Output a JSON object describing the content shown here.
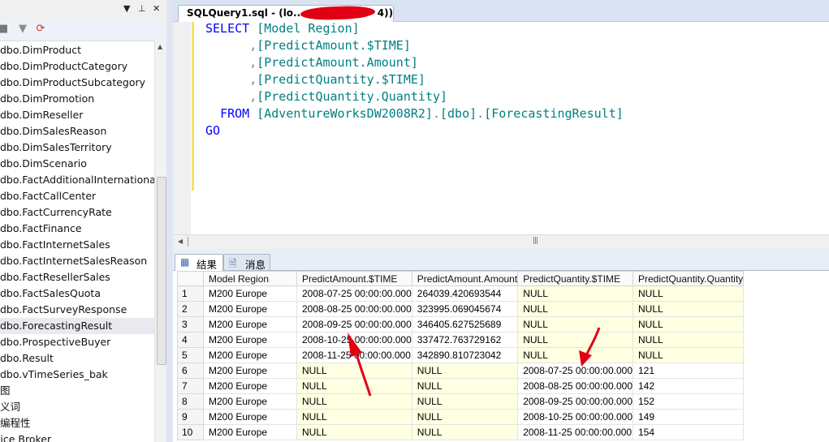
{
  "object_explorer": {
    "tables": [
      "dbo.DimProduct",
      "dbo.DimProductCategory",
      "dbo.DimProductSubcategory",
      "dbo.DimPromotion",
      "dbo.DimReseller",
      "dbo.DimSalesReason",
      "dbo.DimSalesTerritory",
      "dbo.DimScenario",
      "dbo.FactAdditionalInternationalP",
      "dbo.FactCallCenter",
      "dbo.FactCurrencyRate",
      "dbo.FactFinance",
      "dbo.FactInternetSales",
      "dbo.FactInternetSalesReason",
      "dbo.FactResellerSales",
      "dbo.FactSalesQuota",
      "dbo.FactSurveyResponse",
      "dbo.ForecastingResult",
      "dbo.ProspectiveBuyer",
      "dbo.Result",
      "dbo.vTimeSeries_bak"
    ],
    "folders": [
      "图",
      "义词",
      "编程性",
      "vice Broker"
    ],
    "selected_table": "dbo.ForecastingResult",
    "pin_glyph": "▼ ⊥ ✕"
  },
  "editor": {
    "tab_title_prefix": "SQLQuery1.sql - (lo...",
    "tab_title_suffix": "4))",
    "code": {
      "select_kw": "SELECT",
      "col1": "[Model Region]",
      "col2": "[PredictAmount.$TIME]",
      "col3": "[PredictAmount.Amount]",
      "col4": "[PredictQuantity.$TIME]",
      "col5": "[PredictQuantity.Quantity]",
      "from_kw": "FROM",
      "table_db": "[AdventureWorksDW2008R2]",
      "table_schema": "[dbo]",
      "table_name": "[ForecastingResult]",
      "go_kw": "GO"
    }
  },
  "result_tabs": {
    "results_label": "结果",
    "messages_label": "消息"
  },
  "grid": {
    "columns": [
      "Model Region",
      "PredictAmount.$TIME",
      "PredictAmount.Amount",
      "PredictQuantity.$TIME",
      "PredictQuantity.Quantity"
    ],
    "rows": [
      [
        "1",
        "M200 Europe",
        "2008-07-25 00:00:00.000",
        "264039.420693544",
        "NULL",
        "NULL"
      ],
      [
        "2",
        "M200 Europe",
        "2008-08-25 00:00:00.000",
        "323995.069045674",
        "NULL",
        "NULL"
      ],
      [
        "3",
        "M200 Europe",
        "2008-09-25 00:00:00.000",
        "346405.627525689",
        "NULL",
        "NULL"
      ],
      [
        "4",
        "M200 Europe",
        "2008-10-25 00:00:00.000",
        "337472.763729162",
        "NULL",
        "NULL"
      ],
      [
        "5",
        "M200 Europe",
        "2008-11-25 00:00:00.000",
        "342890.810723042",
        "NULL",
        "NULL"
      ],
      [
        "6",
        "M200 Europe",
        "NULL",
        "NULL",
        "2008-07-25 00:00:00.000",
        "121"
      ],
      [
        "7",
        "M200 Europe",
        "NULL",
        "NULL",
        "2008-08-25 00:00:00.000",
        "142"
      ],
      [
        "8",
        "M200 Europe",
        "NULL",
        "NULL",
        "2008-09-25 00:00:00.000",
        "152"
      ],
      [
        "9",
        "M200 Europe",
        "NULL",
        "NULL",
        "2008-10-25 00:00:00.000",
        "149"
      ],
      [
        "10",
        "M200 Europe",
        "NULL",
        "NULL",
        "2008-11-25 00:00:00.000",
        "154"
      ]
    ]
  },
  "colors": {
    "keyword": "#0000ff",
    "identifier": "#008080",
    "null_cell": "#ffffe1",
    "annotation_arrow": "#e10013"
  }
}
